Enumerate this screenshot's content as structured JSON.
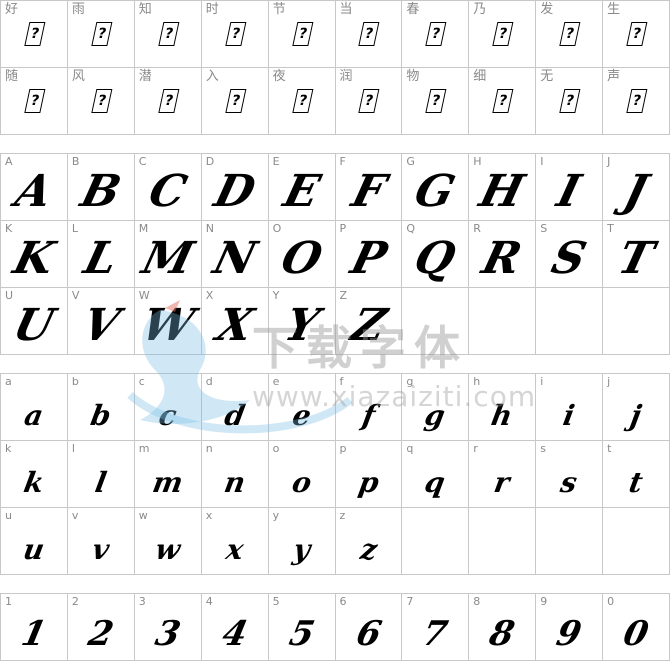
{
  "cjk_labels": [
    "好",
    "雨",
    "知",
    "时",
    "节",
    "当",
    "春",
    "乃",
    "发",
    "生",
    "随",
    "风",
    "潜",
    "入",
    "夜",
    "润",
    "物",
    "细",
    "无",
    "声"
  ],
  "missing_glyph": "?",
  "uppercase": [
    "A",
    "B",
    "C",
    "D",
    "E",
    "F",
    "G",
    "H",
    "I",
    "J",
    "K",
    "L",
    "M",
    "N",
    "O",
    "P",
    "Q",
    "R",
    "S",
    "T",
    "U",
    "V",
    "W",
    "X",
    "Y",
    "Z"
  ],
  "lowercase": [
    "a",
    "b",
    "c",
    "d",
    "e",
    "f",
    "g",
    "h",
    "i",
    "j",
    "k",
    "l",
    "m",
    "n",
    "o",
    "p",
    "q",
    "r",
    "s",
    "t",
    "u",
    "v",
    "w",
    "x",
    "y",
    "z"
  ],
  "digits": [
    "1",
    "2",
    "3",
    "4",
    "5",
    "6",
    "7",
    "8",
    "9",
    "0"
  ],
  "watermark": {
    "title": "下载字体",
    "url": "www.xiazaiziti.com"
  }
}
